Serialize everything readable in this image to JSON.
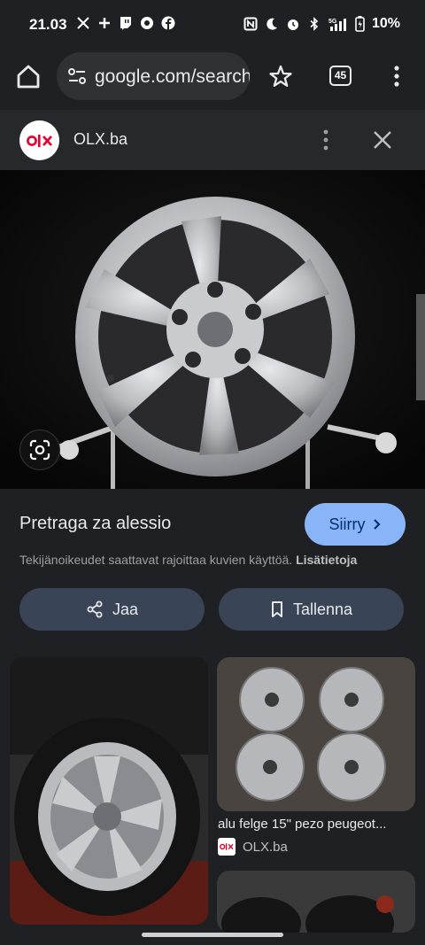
{
  "status_bar": {
    "time": "21.03",
    "battery": "10%",
    "network": "5G"
  },
  "browser": {
    "url": "google.com/search",
    "tab_count": "45"
  },
  "source": {
    "name": "OLX.ba",
    "logo_text": "OLX"
  },
  "result": {
    "title": "Pretraga za alessio",
    "go_label": "Siirry",
    "copyright_text": "Tekijänoikeudet saattavat rajoittaa kuvien käyttöä.",
    "learn_more": "Lisätietoja",
    "share_label": "Jaa",
    "save_label": "Tallenna"
  },
  "related": [
    {
      "caption": "",
      "source": ""
    },
    {
      "caption": "alu felge 15\" pezo peugeot...",
      "source": "OLX.ba"
    },
    {
      "caption": "",
      "source": ""
    }
  ],
  "colors": {
    "background": "#1f2023",
    "accent_button": "#8ab4f8",
    "chip_button": "#394457",
    "olx_red": "#e4002b"
  },
  "icons": [
    "home-icon",
    "site-settings-icon",
    "star-icon",
    "tab-switcher-icon",
    "overflow-menu-icon",
    "close-icon",
    "google-lens-icon",
    "share-icon",
    "bookmark-icon",
    "chevron-right-icon"
  ]
}
